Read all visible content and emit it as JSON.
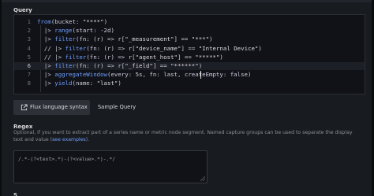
{
  "query_label": "Query",
  "editor": {
    "lines": [
      {
        "num": "1",
        "text": "from(bucket: \"****\")"
      },
      {
        "num": "2",
        "text": "  |> range(start: -2d)"
      },
      {
        "num": "3",
        "text": "  |> filter(fn: (r) => r[\"_measurement\"] == \"***\")"
      },
      {
        "num": "4",
        "text": "  // |> filter(fn: (r) => r[\"device_name\"] == \"Internal Device\")"
      },
      {
        "num": "5",
        "text": "  // |> filter(fn: (r) => r[\"agent_host\"] == \"*****\")"
      },
      {
        "num": "6",
        "text": "  |> filter(fn: (r) => r[\"_field\"] == \"******\")"
      },
      {
        "num": "7",
        "text": "  |> aggregateWindow(every: 5s, fn: last, createEmpty: false)"
      },
      {
        "num": "8",
        "text": "  |> yield(name: \"last\")"
      }
    ],
    "active_line": "6"
  },
  "tabs": {
    "flux_label": "Flux language syntax",
    "flux_icon": "external-link-icon",
    "sample_label": "Sample Query"
  },
  "regex": {
    "label": "Regex",
    "description_pre": "Optional, if you want to extract part of a series name or metric node segment. Named capture groups can be used to separate the display text and value (",
    "description_link1": "see",
    "description_link2": "examples",
    "description_post": ").",
    "value": "/.*-(?<text>.*)-(?<value>.*)-.*/",
    "next_label_fragment": "S"
  },
  "colors": {
    "background": "#181b1f",
    "editor_bg": "#111217",
    "link": "#6e9fff",
    "tab_active_bg": "#2d3037"
  }
}
